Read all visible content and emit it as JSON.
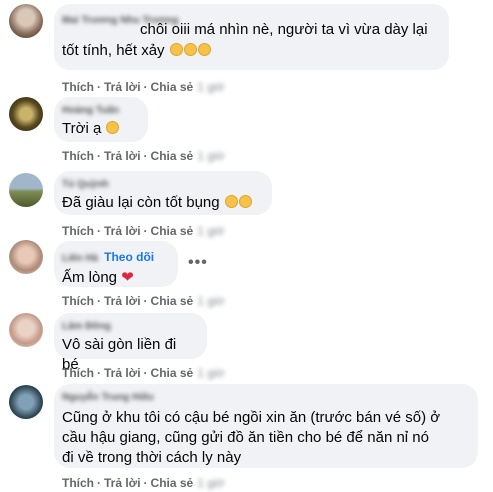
{
  "actions": {
    "like": "Thích",
    "reply": "Trả lời",
    "share": "Chia sẻ",
    "sep": "·"
  },
  "follow_label": "Theo dõi",
  "more_icon": "•••",
  "comments": [
    {
      "author": "Mai Trương Nhu Trương",
      "text_line1": "chôi oiii má nhìn nè, người ta vì vừa dày lại",
      "text_line2": "tốt tính, hết xảy",
      "time": "1 giờ"
    },
    {
      "author": "Hoàng Tuấn",
      "text": "Trời ạ",
      "time": "1 giờ"
    },
    {
      "author": "Tú Quỳnh",
      "text": "Đã giàu lại còn tốt bụng",
      "time": "1 giờ"
    },
    {
      "author": "Liên Hà",
      "text": "Ấm lòng",
      "time": "1 giờ"
    },
    {
      "author": "Lâm Đông",
      "text": "Vô sài gòn liền đi bé",
      "time": "1 giờ"
    },
    {
      "author": "Nguyễn Trung Hiếu",
      "text_line1": "Cũng ở khu tôi có cậu bé ngồi xin ăn (trước bán vé số) ở",
      "text_line2": "cầu hậu giang, cũng gửi đồ ăn tiền cho bé để năn nỉ nó",
      "text_line3": "đi về trong thời cách ly này",
      "time": "1 giờ"
    }
  ]
}
